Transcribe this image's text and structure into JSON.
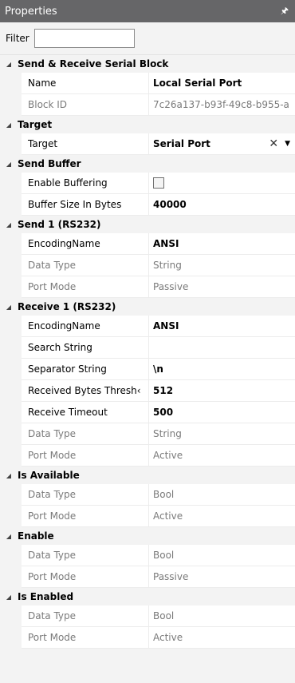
{
  "panel": {
    "title": "Properties",
    "pin_icon": "pin-icon"
  },
  "filter": {
    "label": "Filter",
    "value": ""
  },
  "sections": [
    {
      "name": "Send & Receive Serial Block",
      "rows": [
        {
          "label": "Name",
          "value": "Local Serial Port",
          "readonly": false
        },
        {
          "label": "Block ID",
          "value": "7c26a137-b93f-49c8-b955-a",
          "readonly": true
        }
      ]
    },
    {
      "name": "Target",
      "rows": [
        {
          "label": "Target",
          "value": "Serial Port",
          "readonly": false,
          "clear_icon": "clear-icon",
          "dropdown_icon": "dropdown-arrow-icon"
        }
      ]
    },
    {
      "name": "Send Buffer",
      "rows": [
        {
          "label": "Enable Buffering",
          "checked": false,
          "readonly": false
        },
        {
          "label": "Buffer Size In Bytes",
          "value": "40000",
          "readonly": false
        }
      ]
    },
    {
      "name": "Send 1 (RS232)",
      "rows": [
        {
          "label": "EncodingName",
          "value": "ANSI",
          "readonly": false
        },
        {
          "label": "Data Type",
          "value": "String",
          "readonly": true
        },
        {
          "label": "Port Mode",
          "value": "Passive",
          "readonly": true
        }
      ]
    },
    {
      "name": "Receive 1 (RS232)",
      "rows": [
        {
          "label": "EncodingName",
          "value": "ANSI",
          "readonly": false
        },
        {
          "label": "Search String",
          "value": "",
          "readonly": false
        },
        {
          "label": "Separator String",
          "value": "\\n",
          "readonly": false
        },
        {
          "label": "Received Bytes Thresh‹",
          "value": "512",
          "readonly": false
        },
        {
          "label": "Receive Timeout",
          "value": "500",
          "readonly": false
        },
        {
          "label": "Data Type",
          "value": "String",
          "readonly": true
        },
        {
          "label": "Port Mode",
          "value": "Active",
          "readonly": true
        }
      ]
    },
    {
      "name": "Is Available",
      "rows": [
        {
          "label": "Data Type",
          "value": "Bool",
          "readonly": true
        },
        {
          "label": "Port Mode",
          "value": "Active",
          "readonly": true
        }
      ]
    },
    {
      "name": "Enable",
      "rows": [
        {
          "label": "Data Type",
          "value": "Bool",
          "readonly": true
        },
        {
          "label": "Port Mode",
          "value": "Passive",
          "readonly": true
        }
      ]
    },
    {
      "name": "Is Enabled",
      "rows": [
        {
          "label": "Data Type",
          "value": "Bool",
          "readonly": true
        },
        {
          "label": "Port Mode",
          "value": "Active",
          "readonly": true
        }
      ]
    }
  ]
}
